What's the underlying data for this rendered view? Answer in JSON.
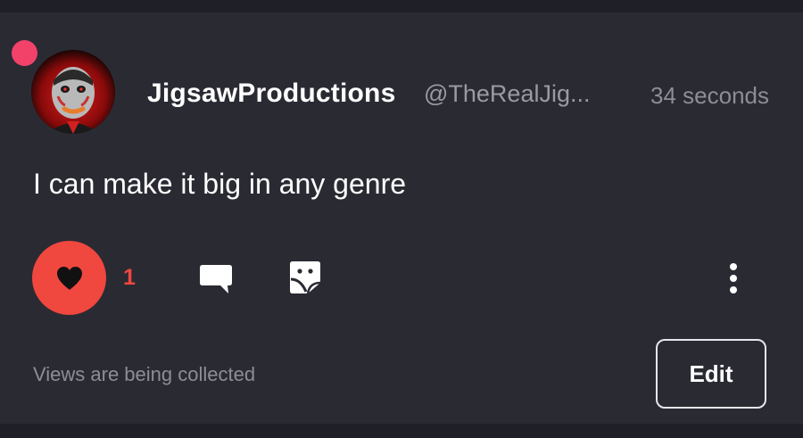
{
  "post": {
    "display_name": "JigsawProductions",
    "handle": "@TheRealJig...",
    "timestamp": "34 seconds",
    "text": "I can make it big in any genre",
    "unread": true
  },
  "actions": {
    "like_count": "1",
    "liked": true,
    "like_icon": "heart-icon",
    "comment_icon": "comment-icon",
    "sticker_icon": "sticker-icon",
    "more_icon": "more-vertical-icon"
  },
  "footer": {
    "views_text": "Views are being collected",
    "edit_label": "Edit"
  },
  "colors": {
    "background": "#1f1f27",
    "card": "#2a2a33",
    "accent_red": "#f0473f",
    "unread_dot": "#f2426a",
    "muted_text": "#8d8d96"
  }
}
